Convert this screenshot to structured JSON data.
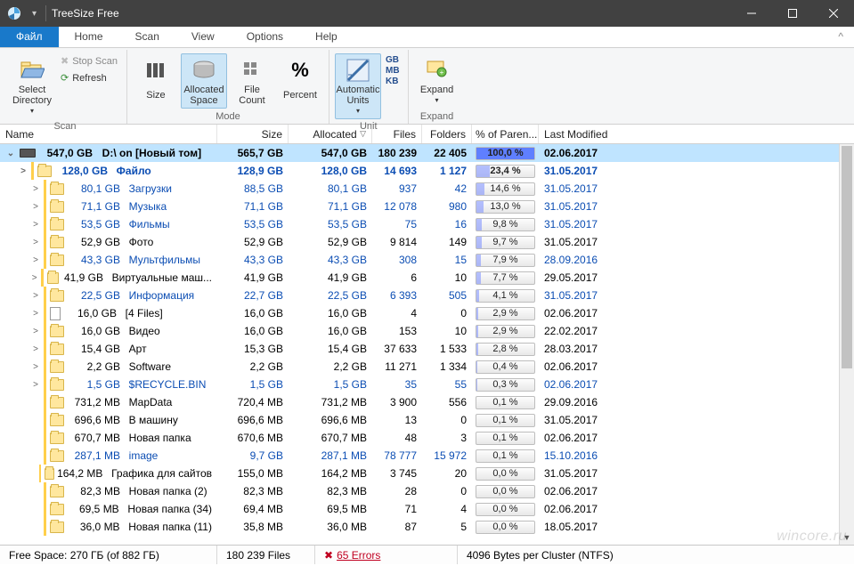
{
  "title": "TreeSize Free",
  "menubar": {
    "file": "Файл",
    "tabs": [
      "Home",
      "Scan",
      "View",
      "Options",
      "Help"
    ]
  },
  "ribbon": {
    "scan": {
      "select_dir": "Select Directory",
      "stop": "Stop Scan",
      "refresh": "Refresh",
      "label": "Scan"
    },
    "mode": {
      "size": "Size",
      "allocated": "Allocated Space",
      "filecount": "File Count",
      "percent": "Percent",
      "label": "Mode"
    },
    "unit": {
      "auto": "Automatic Units",
      "gb": "GB",
      "mb": "MB",
      "kb": "KB",
      "label": "Unit"
    },
    "expand": {
      "expand": "Expand",
      "label": "Expand"
    }
  },
  "columns": {
    "name": "Name",
    "size": "Size",
    "allocated": "Allocated",
    "files": "Files",
    "folders": "Folders",
    "pct": "% of Paren...",
    "modified": "Last Modified"
  },
  "root": {
    "size_label": "547,0 GB",
    "name": "D:\\  on  [Новый том]",
    "size": "565,7 GB",
    "alloc": "547,0 GB",
    "files": "180 239",
    "folders": "22 405",
    "pct": "100,0 %",
    "pct_w": 100,
    "mod": "02.06.2017"
  },
  "rows": [
    {
      "indent": 1,
      "exp": ">",
      "ico": "folder",
      "sizecol": "128,0 GB",
      "name": "Файло",
      "size": "128,9 GB",
      "alloc": "128,0 GB",
      "files": "14 693",
      "folders": "1 127",
      "pct": "23,4 %",
      "pw": 23.4,
      "mod": "31.05.2017",
      "sel": true
    },
    {
      "indent": 2,
      "exp": ">",
      "ico": "folder",
      "sizecol": "80,1 GB",
      "name": "Загрузки",
      "size": "88,5 GB",
      "alloc": "80,1 GB",
      "files": "937",
      "folders": "42",
      "pct": "14,6 %",
      "pw": 14.6,
      "mod": "31.05.2017",
      "link": true
    },
    {
      "indent": 2,
      "exp": ">",
      "ico": "folder",
      "sizecol": "71,1 GB",
      "name": "Музыка",
      "size": "71,1 GB",
      "alloc": "71,1 GB",
      "files": "12 078",
      "folders": "980",
      "pct": "13,0 %",
      "pw": 13,
      "mod": "31.05.2017",
      "link": true
    },
    {
      "indent": 2,
      "exp": ">",
      "ico": "folder",
      "sizecol": "53,5 GB",
      "name": "Фильмы",
      "size": "53,5 GB",
      "alloc": "53,5 GB",
      "files": "75",
      "folders": "16",
      "pct": "9,8 %",
      "pw": 9.8,
      "mod": "31.05.2017",
      "link": true
    },
    {
      "indent": 2,
      "exp": ">",
      "ico": "folder",
      "sizecol": "52,9 GB",
      "name": "Фото",
      "size": "52,9 GB",
      "alloc": "52,9 GB",
      "files": "9 814",
      "folders": "149",
      "pct": "9,7 %",
      "pw": 9.7,
      "mod": "31.05.2017"
    },
    {
      "indent": 2,
      "exp": ">",
      "ico": "folder",
      "sizecol": "43,3 GB",
      "name": "Мультфильмы",
      "size": "43,3 GB",
      "alloc": "43,3 GB",
      "files": "308",
      "folders": "15",
      "pct": "7,9 %",
      "pw": 7.9,
      "mod": "28.09.2016",
      "link": true
    },
    {
      "indent": 2,
      "exp": ">",
      "ico": "folder",
      "sizecol": "41,9 GB",
      "name": "Виртуальные маш...",
      "size": "41,9 GB",
      "alloc": "41,9 GB",
      "files": "6",
      "folders": "10",
      "pct": "7,7 %",
      "pw": 7.7,
      "mod": "29.05.2017"
    },
    {
      "indent": 2,
      "exp": ">",
      "ico": "folder",
      "sizecol": "22,5 GB",
      "name": "Информация",
      "size": "22,7 GB",
      "alloc": "22,5 GB",
      "files": "6 393",
      "folders": "505",
      "pct": "4,1 %",
      "pw": 4.1,
      "mod": "31.05.2017",
      "link": true
    },
    {
      "indent": 2,
      "exp": ">",
      "ico": "file",
      "sizecol": "16,0 GB",
      "name": "[4 Files]",
      "size": "16,0 GB",
      "alloc": "16,0 GB",
      "files": "4",
      "folders": "0",
      "pct": "2,9 %",
      "pw": 2.9,
      "mod": "02.06.2017"
    },
    {
      "indent": 2,
      "exp": ">",
      "ico": "folder",
      "sizecol": "16,0 GB",
      "name": "Видео",
      "size": "16,0 GB",
      "alloc": "16,0 GB",
      "files": "153",
      "folders": "10",
      "pct": "2,9 %",
      "pw": 2.9,
      "mod": "22.02.2017"
    },
    {
      "indent": 2,
      "exp": ">",
      "ico": "folder",
      "sizecol": "15,4 GB",
      "name": "Арт",
      "size": "15,3 GB",
      "alloc": "15,4 GB",
      "files": "37 633",
      "folders": "1 533",
      "pct": "2,8 %",
      "pw": 2.8,
      "mod": "28.03.2017"
    },
    {
      "indent": 2,
      "exp": ">",
      "ico": "folder",
      "sizecol": "2,2 GB",
      "name": "Software",
      "size": "2,2 GB",
      "alloc": "2,2 GB",
      "files": "11 271",
      "folders": "1 334",
      "pct": "0,4 %",
      "pw": 0.4,
      "mod": "02.06.2017"
    },
    {
      "indent": 2,
      "exp": ">",
      "ico": "folder",
      "sizecol": "1,5 GB",
      "name": "$RECYCLE.BIN",
      "size": "1,5 GB",
      "alloc": "1,5 GB",
      "files": "35",
      "folders": "55",
      "pct": "0,3 %",
      "pw": 0.3,
      "mod": "02.06.2017",
      "link": true
    },
    {
      "indent": 2,
      "exp": "",
      "ico": "folder",
      "sizecol": "731,2 MB",
      "name": "MapData",
      "size": "720,4 MB",
      "alloc": "731,2 MB",
      "files": "3 900",
      "folders": "556",
      "pct": "0,1 %",
      "pw": 0.1,
      "mod": "29.09.2016"
    },
    {
      "indent": 2,
      "exp": "",
      "ico": "folder",
      "sizecol": "696,6 MB",
      "name": "В машину",
      "size": "696,6 MB",
      "alloc": "696,6 MB",
      "files": "13",
      "folders": "0",
      "pct": "0,1 %",
      "pw": 0.1,
      "mod": "31.05.2017"
    },
    {
      "indent": 2,
      "exp": "",
      "ico": "folder",
      "sizecol": "670,7 MB",
      "name": "Новая папка",
      "size": "670,6 MB",
      "alloc": "670,7 MB",
      "files": "48",
      "folders": "3",
      "pct": "0,1 %",
      "pw": 0.1,
      "mod": "02.06.2017"
    },
    {
      "indent": 2,
      "exp": "",
      "ico": "folder",
      "sizecol": "287,1 MB",
      "name": "image",
      "size": "9,7 GB",
      "alloc": "287,1 MB",
      "files": "78 777",
      "folders": "15 972",
      "pct": "0,1 %",
      "pw": 0.1,
      "mod": "15.10.2016",
      "link": true
    },
    {
      "indent": 2,
      "exp": "",
      "ico": "folder",
      "sizecol": "164,2 MB",
      "name": "Графика для сайтов",
      "size": "155,0 MB",
      "alloc": "164,2 MB",
      "files": "3 745",
      "folders": "20",
      "pct": "0,0 %",
      "pw": 0,
      "mod": "31.05.2017"
    },
    {
      "indent": 2,
      "exp": "",
      "ico": "folder",
      "sizecol": "82,3 MB",
      "name": "Новая папка (2)",
      "size": "82,3 MB",
      "alloc": "82,3 MB",
      "files": "28",
      "folders": "0",
      "pct": "0,0 %",
      "pw": 0,
      "mod": "02.06.2017"
    },
    {
      "indent": 2,
      "exp": "",
      "ico": "folder",
      "sizecol": "69,5 MB",
      "name": "Новая папка (34)",
      "size": "69,4 MB",
      "alloc": "69,5 MB",
      "files": "71",
      "folders": "4",
      "pct": "0,0 %",
      "pw": 0,
      "mod": "02.06.2017"
    },
    {
      "indent": 2,
      "exp": "",
      "ico": "folder",
      "sizecol": "36,0 MB",
      "name": "Новая папка (11)",
      "size": "35,8 MB",
      "alloc": "36,0 MB",
      "files": "87",
      "folders": "5",
      "pct": "0,0 %",
      "pw": 0,
      "mod": "18.05.2017"
    }
  ],
  "status": {
    "freespace": "Free Space: 270 ГБ  (of 882 ГБ)",
    "files": "180 239  Files",
    "errors": "65 Errors",
    "cluster": "4096  Bytes per Cluster (NTFS)"
  },
  "watermark": "wincore.ru"
}
